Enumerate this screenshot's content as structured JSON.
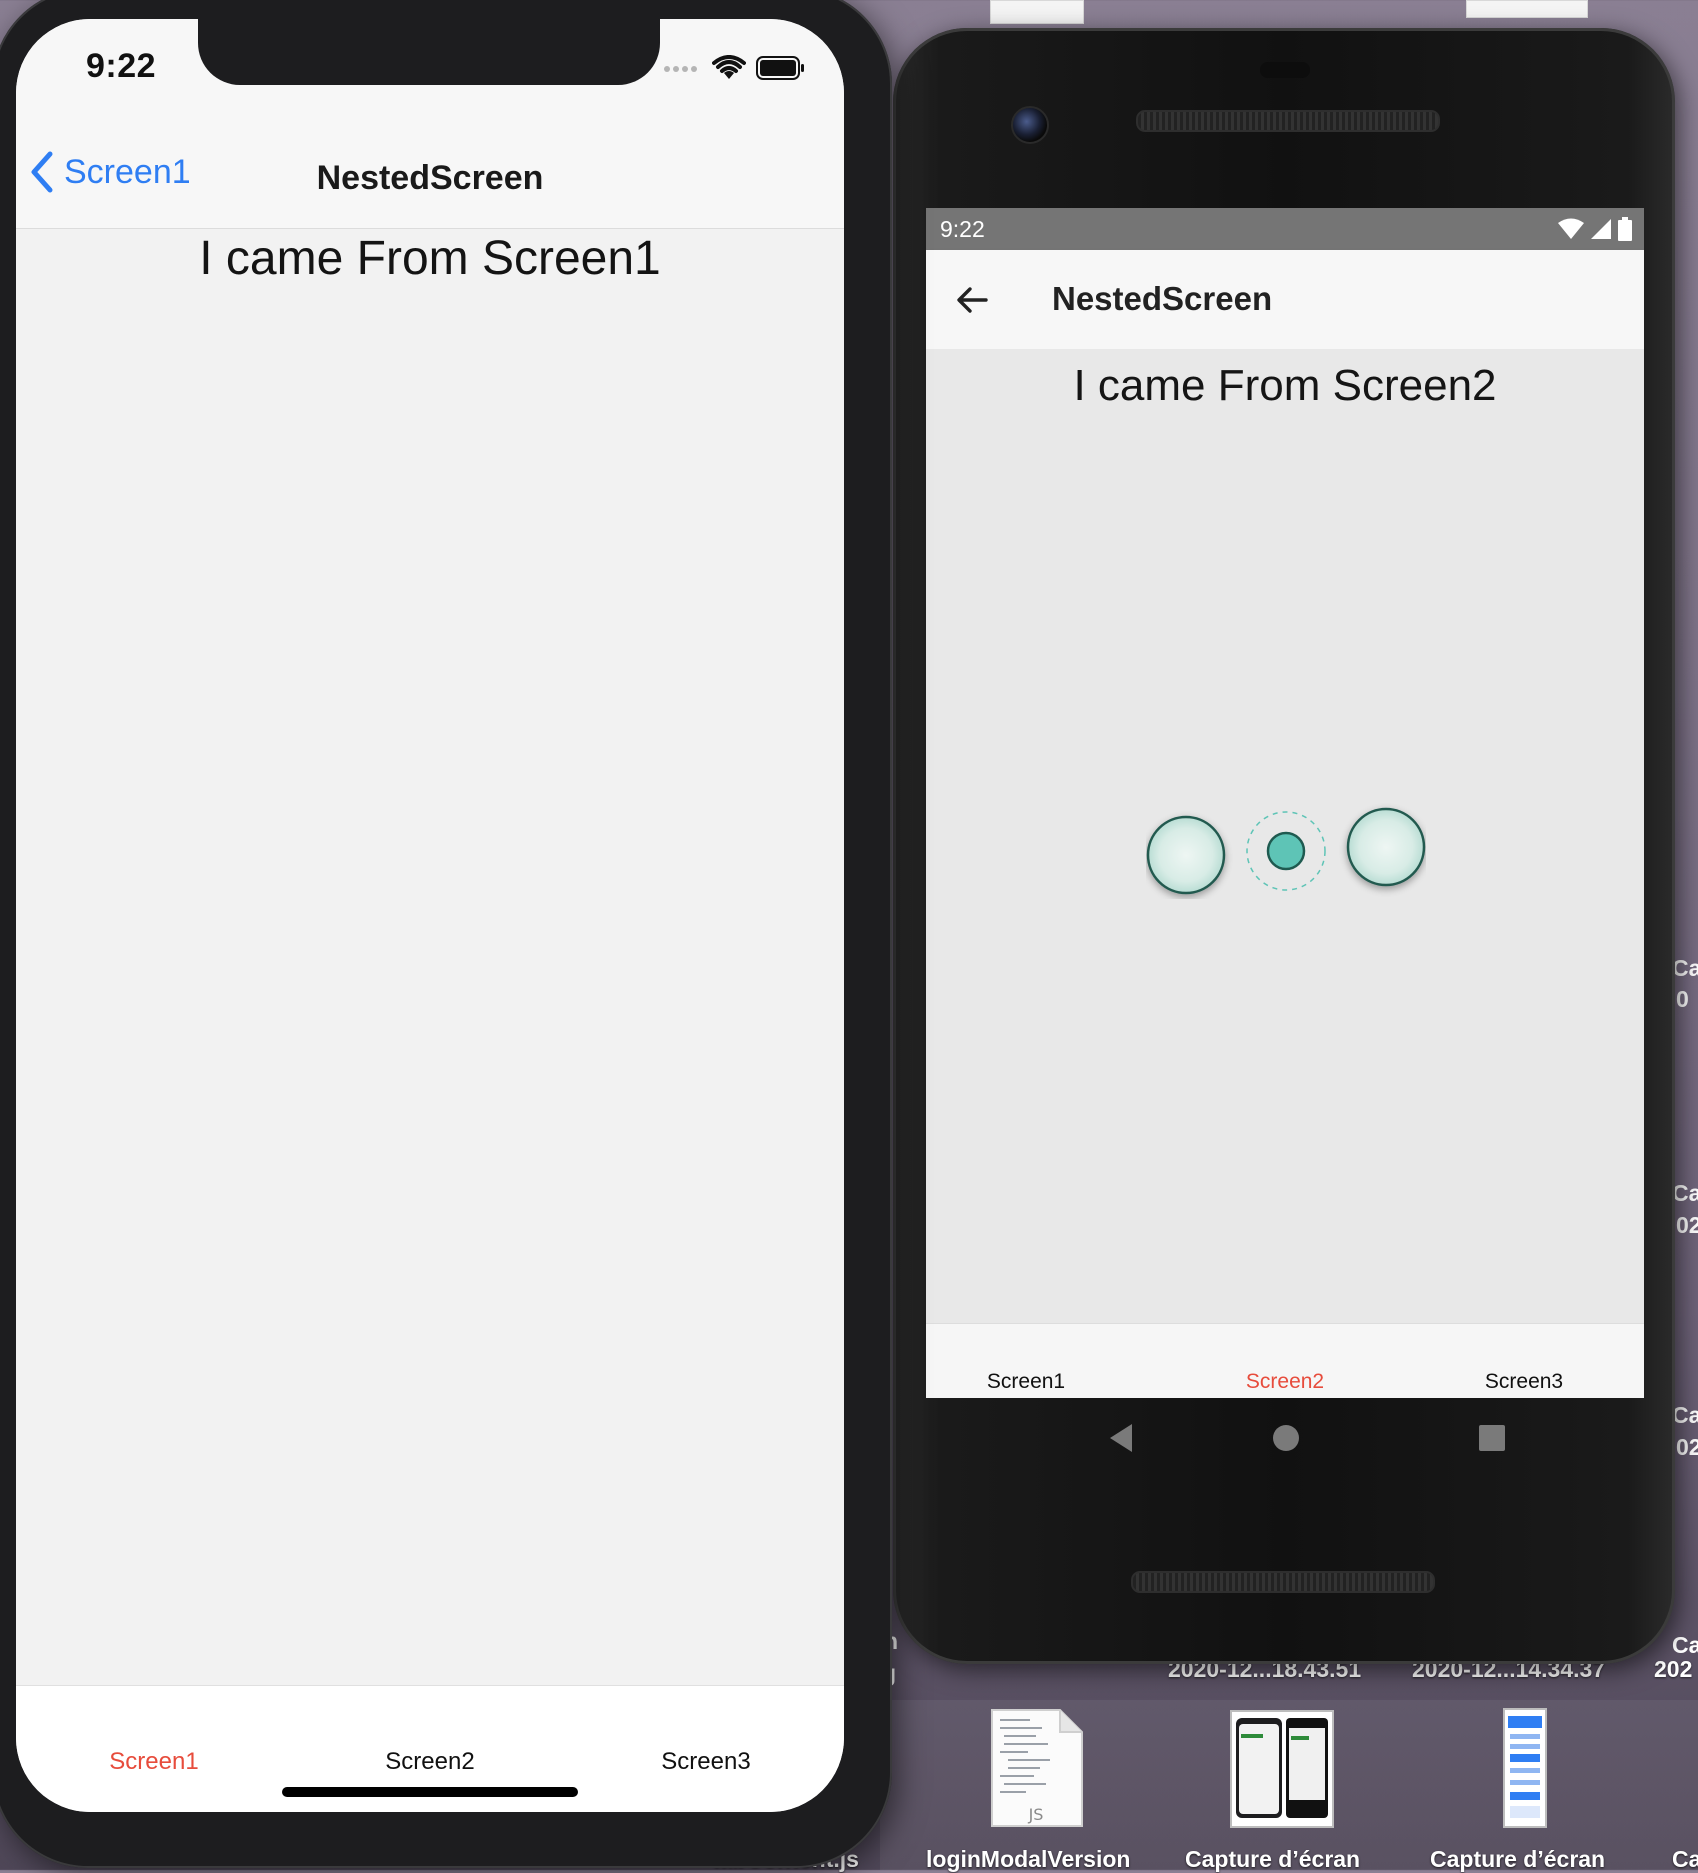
{
  "ios": {
    "status_time": "9:22",
    "back_label": "Screen1",
    "title": "NestedScreen",
    "body_text": "I came From Screen1",
    "tabs": [
      {
        "label": "Screen1",
        "active": true
      },
      {
        "label": "Screen2",
        "active": false
      },
      {
        "label": "Screen3",
        "active": false
      }
    ],
    "colors": {
      "accent": "#2f7ef3",
      "active_tab": "#e74c3c"
    }
  },
  "android": {
    "status_time": "9:22",
    "title": "NestedScreen",
    "body_text": "I came From Screen2",
    "tabs": [
      {
        "label": "Screen1",
        "active": false
      },
      {
        "label": "Screen2",
        "active": true
      },
      {
        "label": "Screen3",
        "active": false
      }
    ],
    "loading_indicator": "teal-three-dot-spinner",
    "colors": {
      "spinner": "#5ec4b6",
      "active_tab": "#e74c3c"
    }
  },
  "desktop": {
    "timestamp_labels": [
      "2020-12...18.43.51",
      "2020-12...14.34.37",
      "202"
    ],
    "files": [
      {
        "name": "tabContent.js"
      },
      {
        "name": "loginModalVersion",
        "badge": "JS"
      },
      {
        "name": "Capture d’écran"
      },
      {
        "name": "Capture d’écran"
      },
      {
        "name": "Ca"
      }
    ],
    "edge_fragments": [
      "Ca",
      "0",
      "Ca",
      "02",
      "Ca",
      "02",
      "Ca",
      "g",
      "n"
    ]
  }
}
